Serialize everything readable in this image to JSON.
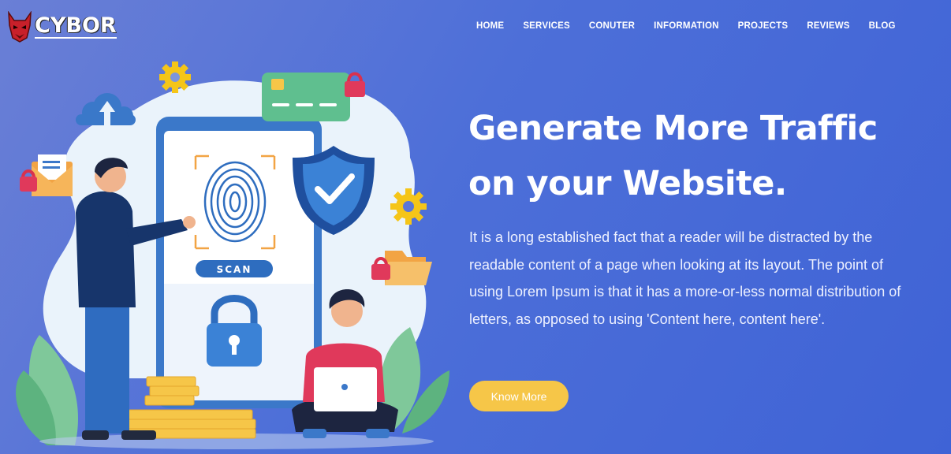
{
  "header": {
    "logo_text": "CYBOR",
    "nav": [
      "HOME",
      "SERVICES",
      "CONUTER",
      "INFORMATION",
      "PROJECTS",
      "REVIEWS",
      "BLOG"
    ]
  },
  "hero": {
    "headline_line1": "Generate More Traffic",
    "headline_line2": "on your Website.",
    "description": "It is a long established fact that a reader will be distracted by the readable content of a page when looking at its layout. The point of using Lorem Ipsum is that it has a more-or-less normal distribution of letters, as opposed to using 'Content here, content here'.",
    "cta_label": "Know More"
  },
  "illustration": {
    "scan_label": "SCAN",
    "icons": [
      "gear-icon",
      "cloud-upload-icon",
      "credit-card-icon",
      "padlock-icon",
      "mail-icon",
      "shield-check-icon",
      "fingerprint-icon",
      "folder-icon",
      "coins-icon",
      "laptop-icon"
    ]
  },
  "colors": {
    "background": "#4d6fd8",
    "accent_yellow": "#f6c648",
    "text": "#ffffff"
  }
}
